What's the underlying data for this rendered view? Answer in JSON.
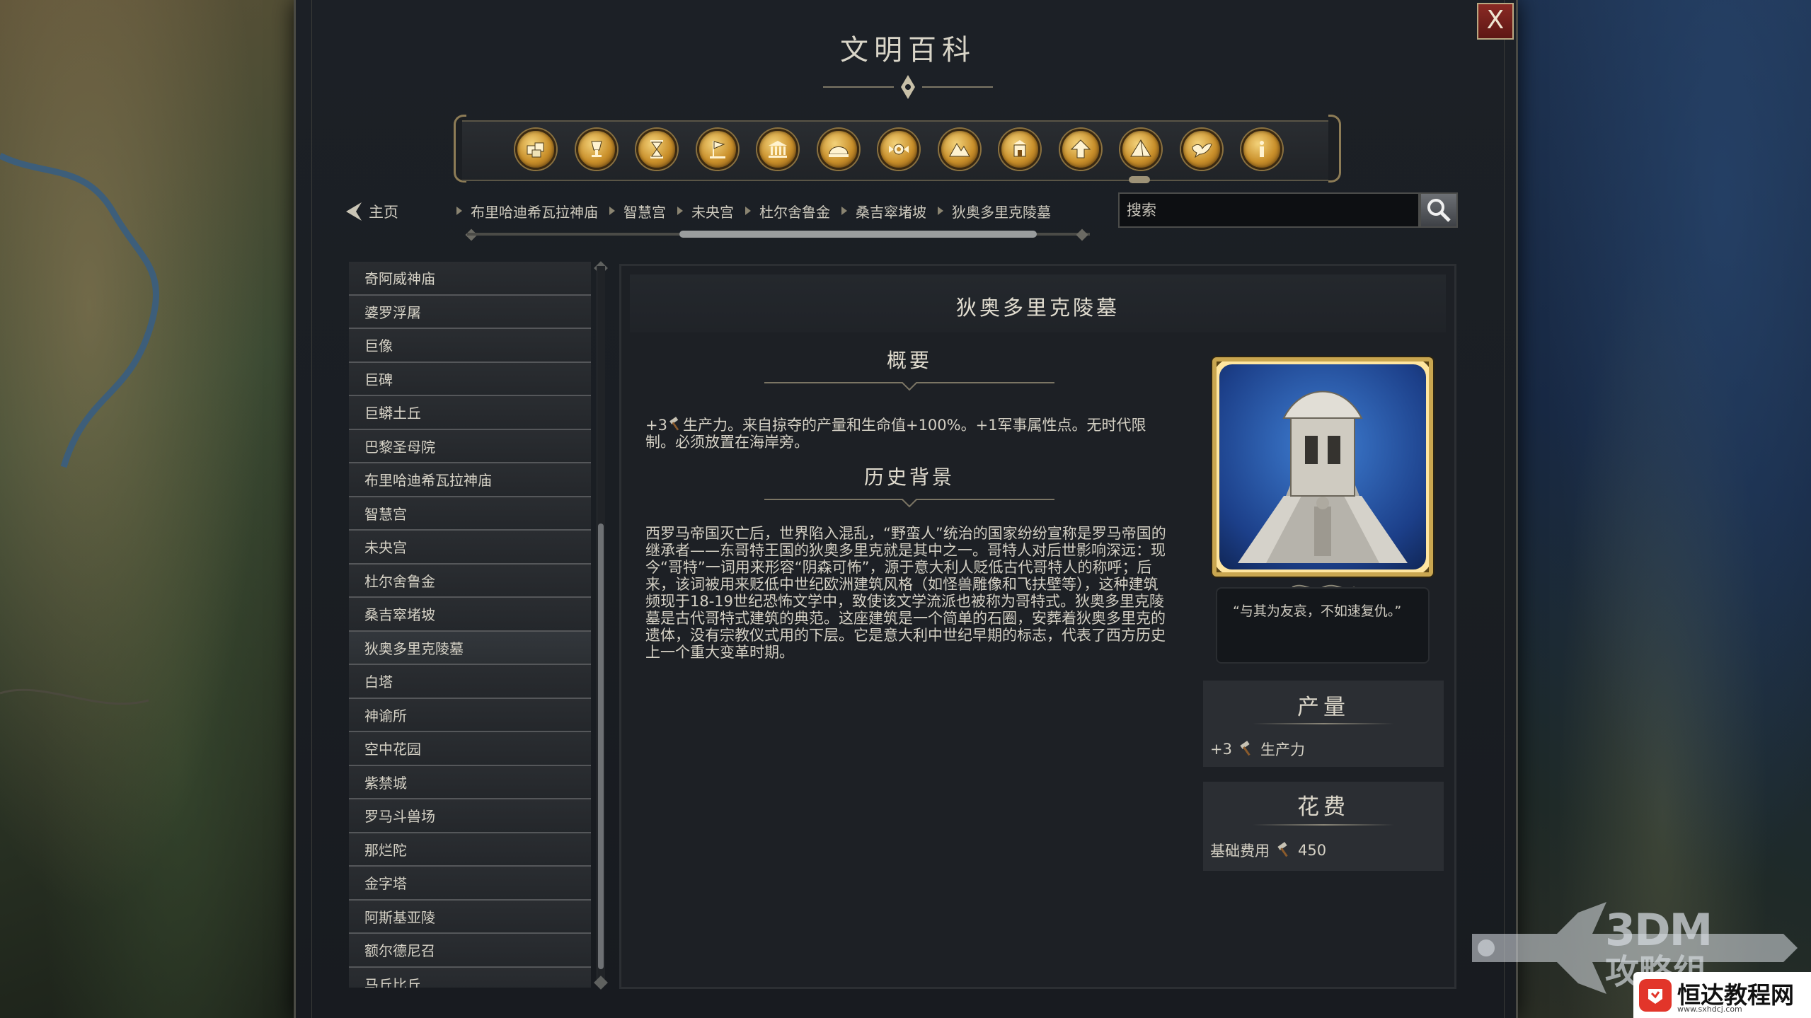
{
  "window": {
    "title": "文明百科",
    "close_label": "X"
  },
  "categories": [
    {
      "name": "units",
      "icon": "boxes-icon"
    },
    {
      "name": "buildings",
      "icon": "goblet-icon"
    },
    {
      "name": "eras",
      "icon": "hourglass-icon"
    },
    {
      "name": "civilizations",
      "icon": "flag-icon"
    },
    {
      "name": "governments",
      "icon": "temple-icon"
    },
    {
      "name": "resources",
      "icon": "dome-icon"
    },
    {
      "name": "religions",
      "icon": "emblem-icon"
    },
    {
      "name": "terrain",
      "icon": "mountain-icon"
    },
    {
      "name": "improvements",
      "icon": "building-icon"
    },
    {
      "name": "promotions",
      "icon": "arrow-up-icon"
    },
    {
      "name": "wonders",
      "icon": "pyramid-icon",
      "active": true
    },
    {
      "name": "diplomacy",
      "icon": "dove-icon"
    },
    {
      "name": "concepts",
      "icon": "info-icon"
    }
  ],
  "nav": {
    "home_label": "主页",
    "breadcrumb": [
      "布里哈迪希瓦拉神庙",
      "智慧宫",
      "未央宫",
      "杜尔舍鲁金",
      "桑吉窣堵坡",
      "狄奥多里克陵墓"
    ],
    "search_placeholder": "搜索"
  },
  "list": {
    "items": [
      "奇阿威神庙",
      "婆罗浮屠",
      "巨像",
      "巨碑",
      "巨蟒土丘",
      "巴黎圣母院",
      "布里哈迪希瓦拉神庙",
      "智慧宫",
      "未央宫",
      "杜尔舍鲁金",
      "桑吉窣堵坡",
      "狄奥多里克陵墓",
      "白塔",
      "神谕所",
      "空中花园",
      "紫禁城",
      "罗马斗兽场",
      "那烂陀",
      "金字塔",
      "阿斯基亚陵",
      "额尔德尼召",
      "马丘比丘"
    ],
    "selected": "狄奥多里克陵墓"
  },
  "detail": {
    "title": "狄奥多里克陵墓",
    "overview_heading": "概要",
    "overview_prefix": "+3",
    "overview_text": "生产力。来自掠夺的产量和生命值+100%。+1军事属性点。无时代限制。必须放置在海岸旁。",
    "history_heading": "历史背景",
    "history_text": "西罗马帝国灭亡后，世界陷入混乱，“野蛮人”统治的国家纷纷宣称是罗马帝国的继承者——东哥特王国的狄奥多里克就是其中之一。哥特人对后世影响深远：现今“哥特”一词用来形容“阴森可怖”，源于意大利人贬低古代哥特人的称呼；后来，该词被用来贬低中世纪欧洲建筑风格（如怪兽雕像和飞扶壁等），这种建筑频现于18-19世纪恐怖文学中，致使该文学流派也被称为哥特式。狄奥多里克陵墓是古代哥特式建筑的典范。这座建筑是一个简单的石圈，安葬着狄奥多里克的遗体，没有宗教仪式用的下层。它是意大利中世纪早期的标志，代表了西方历史上一个重大变革时期。",
    "quote": "“与其为友哀，不如速复仇。”",
    "yield": {
      "heading": "产量",
      "value": "+3",
      "label": "生产力"
    },
    "cost": {
      "heading": "花费",
      "label": "基础费用",
      "value": "450"
    }
  },
  "watermarks": {
    "site_3dm": "3DM",
    "site_3dm_sub": "攻略组",
    "hengda_name": "恒达教程网",
    "hengda_url": "www.sxhdcj.com"
  },
  "colors": {
    "gold_icon": "#c98f2a",
    "close_red": "#8a2a24",
    "panel": "#1d2025"
  }
}
